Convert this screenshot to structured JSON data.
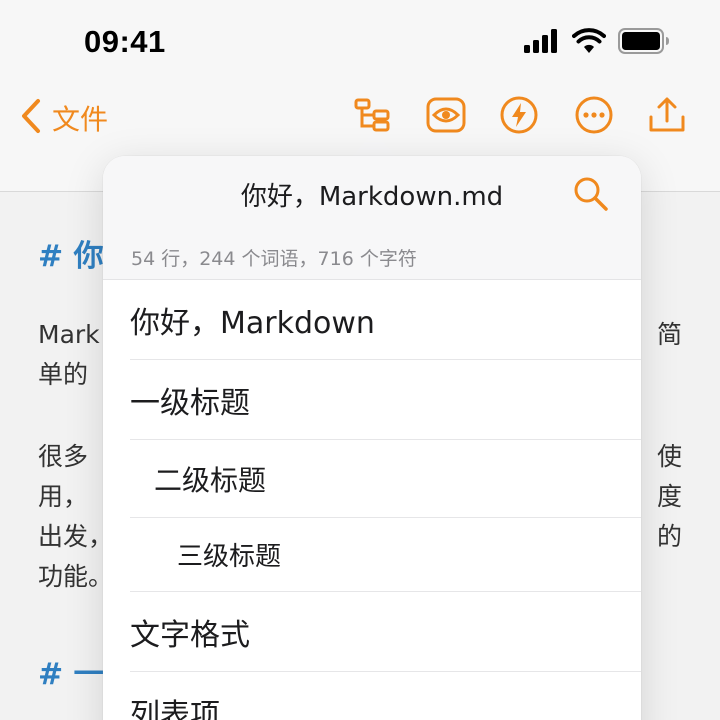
{
  "status_bar": {
    "time": "09:41",
    "icons": [
      "cellular-signal-icon",
      "wifi-icon",
      "battery-icon"
    ]
  },
  "nav": {
    "back_label": "文件",
    "toolbar": [
      "outline-icon",
      "preview-eye-icon",
      "quick-action-bolt-icon",
      "more-icon",
      "share-icon"
    ]
  },
  "colors": {
    "accent": "#f0891e",
    "heading_blue": "#2f7fc1"
  },
  "editor": {
    "heading1": "# 你",
    "para1_line1_left": "Mark",
    "para1_line1_right": "简",
    "para1_line2_left": "单的",
    "para2_line1_left": "很多",
    "para2_line1_right": "使",
    "para2_line2_left": "用，",
    "para2_line2_right": "度",
    "para2_line3_left": "出发，",
    "para2_line3_right": "的",
    "para2_line4_left": "功能。",
    "heading2": "# 一"
  },
  "popover": {
    "title": "你好，Markdown.md",
    "stats": "54 行，244 个词语，716 个字符",
    "items": [
      {
        "label": "你好，Markdown",
        "level": 1
      },
      {
        "label": "一级标题",
        "level": 1
      },
      {
        "label": "二级标题",
        "level": 2
      },
      {
        "label": "三级标题",
        "level": 3
      },
      {
        "label": "文字格式",
        "level": 1
      },
      {
        "label": "列表项",
        "level": 1
      }
    ]
  }
}
